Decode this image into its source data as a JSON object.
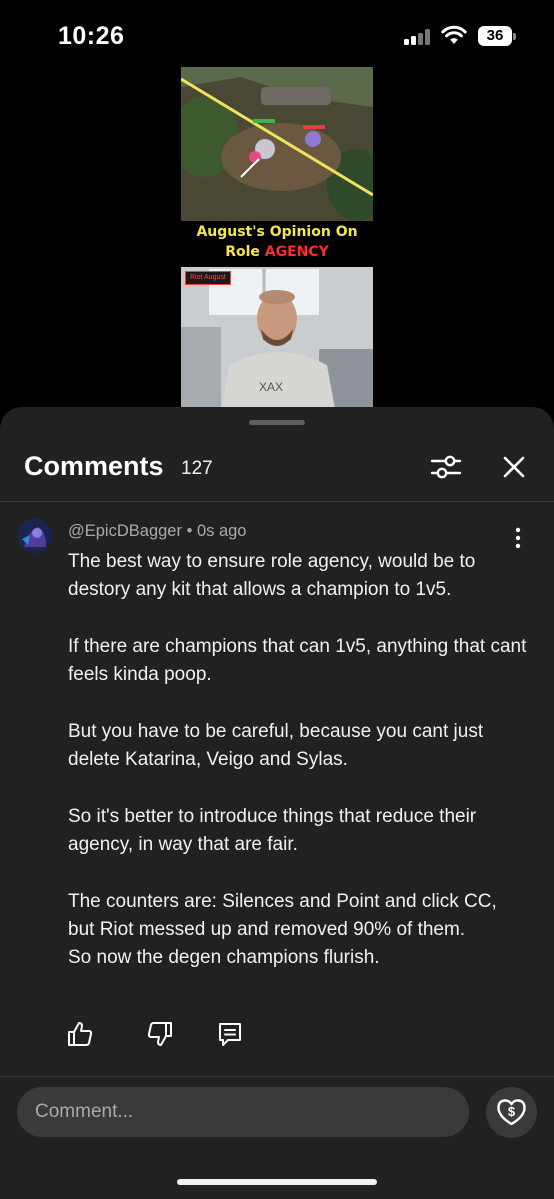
{
  "status_bar": {
    "time": "10:26",
    "battery_level": "36",
    "icons": [
      "cellular-signal-icon",
      "wifi-icon",
      "battery-icon"
    ]
  },
  "video": {
    "title_line1": "August's Opinion On",
    "title_role": "Role ",
    "title_agency": "AGENCY",
    "webcam_tag": "Riot August",
    "colors": {
      "title_yellow": "#f3e54a",
      "title_red": "#ff2a2a"
    }
  },
  "comments": {
    "title": "Comments",
    "count": "127",
    "icons": [
      "filter-sliders-icon",
      "close-icon"
    ]
  },
  "comment": {
    "author": "@EpicDBagger",
    "separator": " • ",
    "time": "0s ago",
    "paragraphs": [
      "The best way to ensure role agency, would be to destory any kit that allows a champion to 1v5.",
      "If there are champions that can 1v5, anything that cant feels kinda poop.",
      "But you have to be careful, because you cant just delete Katarina, Veigo and Sylas.",
      "So it's better to introduce things that reduce their agency, in way that are fair.",
      "The counters are: Silences and Point and click CC, but Riot messed up and removed 90% of them.\nSo now the degen champions flurish."
    ],
    "action_icons": [
      "thumbs-up-icon",
      "thumbs-down-icon",
      "reply-icon",
      "more-vertical-icon"
    ]
  },
  "composer": {
    "placeholder": "Comment...",
    "thanks_icon": "super-thanks-icon"
  }
}
